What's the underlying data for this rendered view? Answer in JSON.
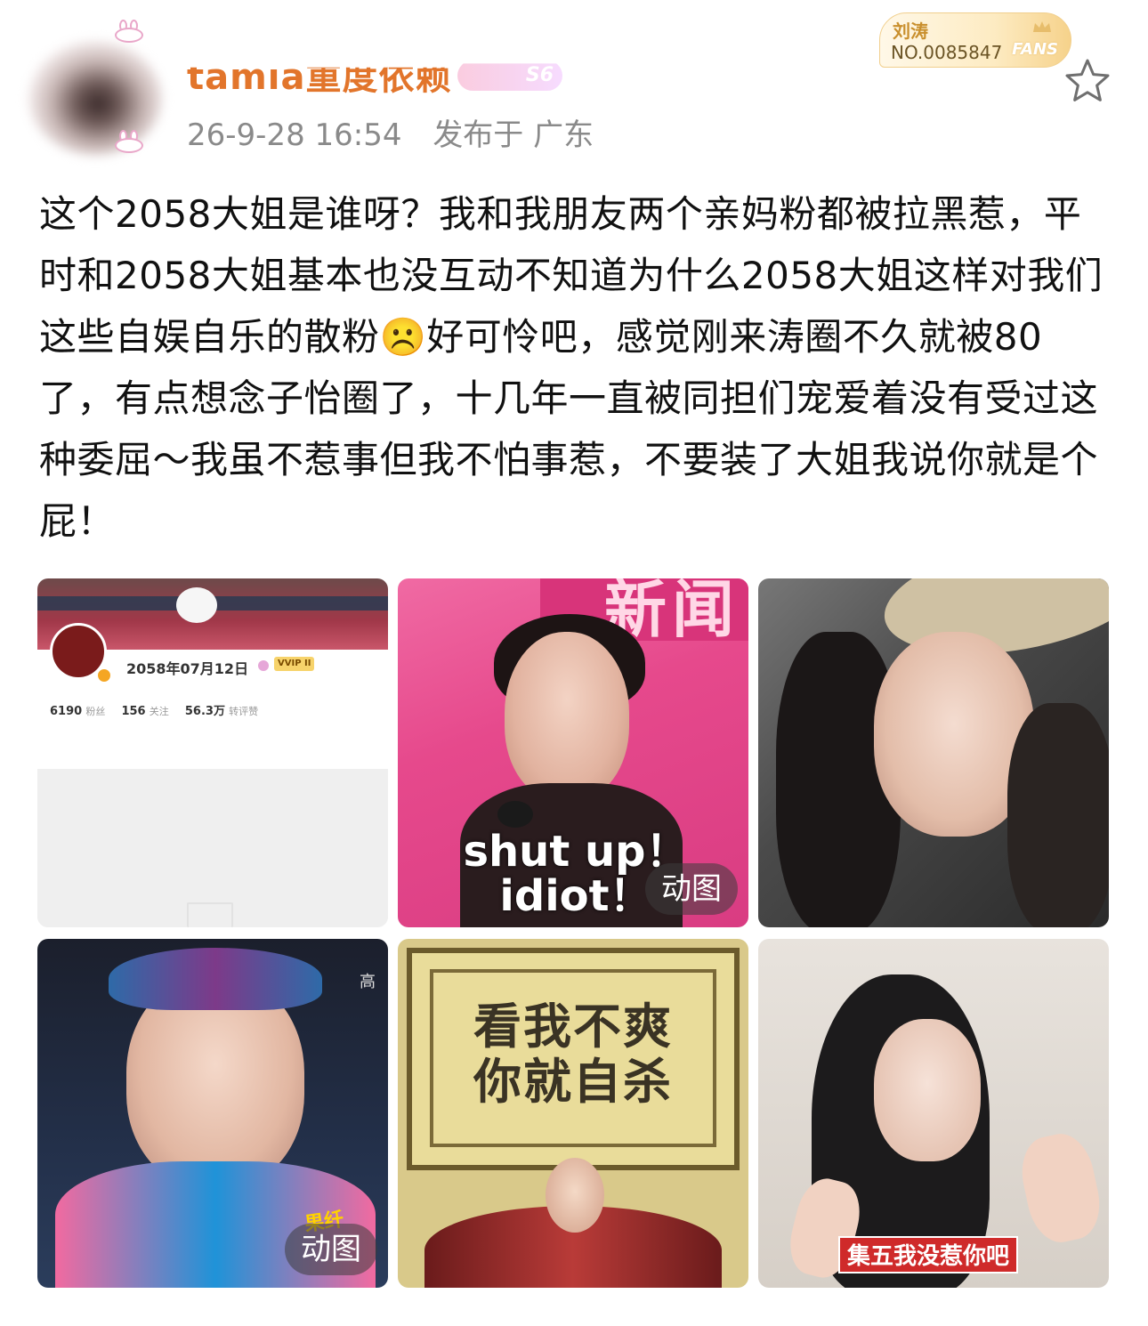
{
  "header": {
    "user_name": "tamia重度依赖",
    "badge_text": "S6",
    "timestamp": "26-9-28 16:54",
    "location": "发布于 广东"
  },
  "fan_card": {
    "name": "刘涛",
    "number": "NO.0085847",
    "label": "FANS",
    "accent": "#f1cf8d"
  },
  "actions": {
    "favorite_icon": "star-outline-icon"
  },
  "post": {
    "text": "这个2058大姐是谁呀？我和我朋友两个亲妈粉都被拉黑惹，平时和2058大姐基本也没互动不知道为什么2058大姐这样对我们这些自娱自乐的散粉☹️好可怜吧，感觉刚来涛圈不久就被80了，有点想念子怡圈了，十几年一直被同担们宠爱着没有受过这种委屈～我虽不惹事但我不怕事惹，不要装了大姐我说你就是个屁！"
  },
  "images": [
    {
      "kind": "profile-screenshot",
      "profile": {
        "date": "2058年07月12日",
        "vip": "VVIP II",
        "fans_count": "6190",
        "fans_label": "粉丝",
        "following_count": "156",
        "following_label": "关注",
        "likes_count": "56.3万",
        "likes_label": "转评赞"
      }
    },
    {
      "kind": "gif",
      "caption_line1": "shut up！",
      "caption_line2": "idiot！",
      "sign_text": "新闻",
      "badge": "动图"
    },
    {
      "kind": "photo"
    },
    {
      "kind": "gif",
      "corner_text": "高",
      "logo_text": "果纤",
      "badge": "动图"
    },
    {
      "kind": "photo",
      "sign_line1": "看我不爽",
      "sign_line2": "你就自杀"
    },
    {
      "kind": "photo",
      "subtitle": "集五我没惹你吧"
    }
  ],
  "colors": {
    "name": "#e2752b",
    "meta": "#8a8a8a",
    "text": "#111111",
    "gif_badge_bg": "rgba(60,60,60,0.55)"
  }
}
